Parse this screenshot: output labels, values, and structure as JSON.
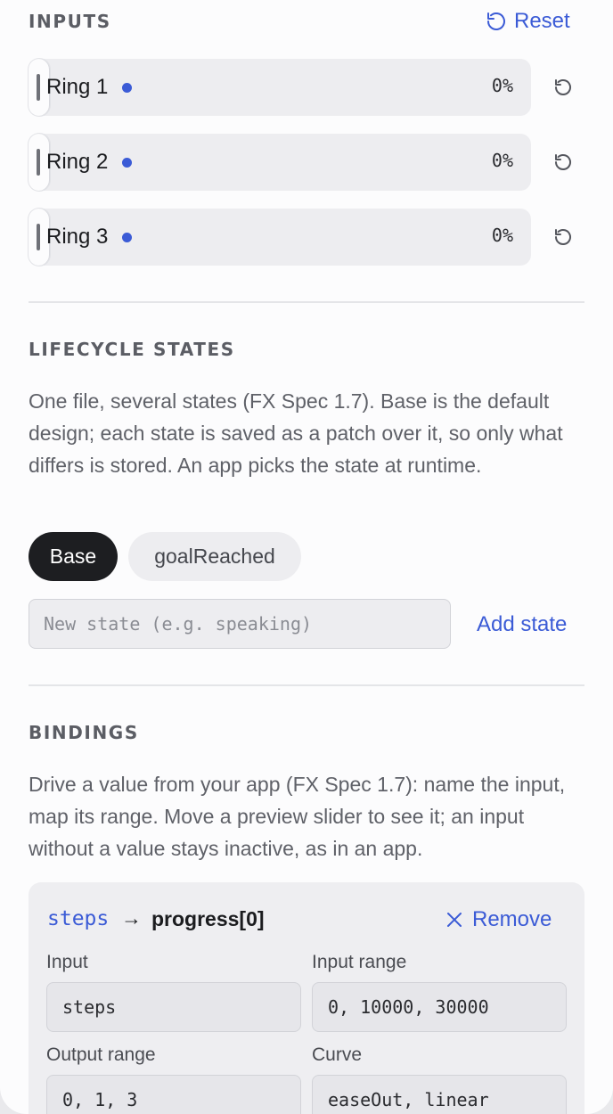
{
  "inputs": {
    "heading": "INPUTS",
    "reset_label": "Reset",
    "rings": [
      {
        "label": "Ring 1",
        "value": "0%"
      },
      {
        "label": "Ring 2",
        "value": "0%"
      },
      {
        "label": "Ring 3",
        "value": "0%"
      }
    ]
  },
  "lifecycle": {
    "heading": "LIFECYCLE STATES",
    "description": "One file, several states (FX Spec 1.7). Base is the default design; each state is saved as a patch over it, so only what differs is stored. An app picks the state at runtime.",
    "states": [
      "Base",
      "goalReached"
    ],
    "selected_state": "Base",
    "new_state_placeholder": "New state (e.g. speaking)",
    "new_state_value": "",
    "add_state_label": "Add state"
  },
  "bindings": {
    "heading": "BINDINGS",
    "description": "Drive a value from your app (FX Spec 1.7): name the input, map its range. Move a preview slider to see it; an input without a value stays inactive, as in an app.",
    "items": [
      {
        "source": "steps",
        "arrow": "→",
        "target": "progress[0]",
        "remove_label": "Remove",
        "input_label": "Input",
        "input_value": "steps",
        "input_range_label": "Input range",
        "input_range_value": "0, 10000, 30000",
        "output_range_label": "Output range",
        "output_range_value": "0, 1, 3",
        "curve_label": "Curve",
        "curve_value": "easeOut, linear"
      }
    ]
  },
  "colors": {
    "accent": "#3b5bd6",
    "selected_chip": "#1d1e21",
    "chip": "#ededf0"
  },
  "icons": {
    "reset": "reset-icon",
    "ring_reset": "reset-icon",
    "remove": "close-icon"
  }
}
